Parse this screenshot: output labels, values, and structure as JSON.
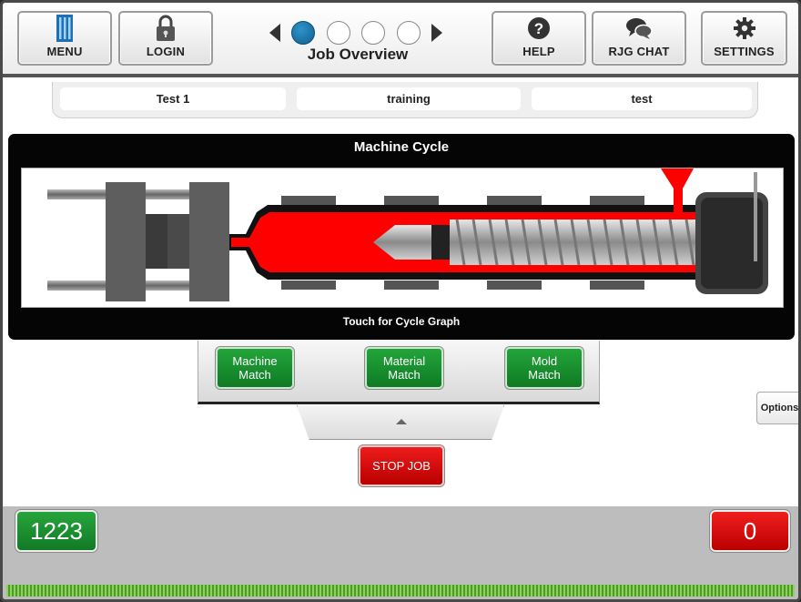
{
  "header": {
    "menu_label": "MENU",
    "login_label": "LOGIN",
    "help_label": "HELP",
    "chat_label": "RJG CHAT",
    "settings_label": "SETTINGS",
    "page_title": "Job Overview",
    "pager": {
      "count": 4,
      "active_index": 0
    }
  },
  "job_tabs": [
    {
      "label": "Test 1"
    },
    {
      "label": "training"
    },
    {
      "label": "test"
    }
  ],
  "cycle": {
    "title": "Machine Cycle",
    "subtitle": "Touch for Cycle Graph"
  },
  "match_buttons": {
    "machine": "Machine\nMatch",
    "material": "Material\nMatch",
    "mold": "Mold\nMatch"
  },
  "stop_label": "STOP JOB",
  "options_label": "Options",
  "counters": {
    "good": "1223",
    "bad": "0"
  },
  "colors": {
    "green": "#1a8f30",
    "red": "#d40000",
    "melt": "#ff0000",
    "pager_active": "#1a74a8"
  }
}
